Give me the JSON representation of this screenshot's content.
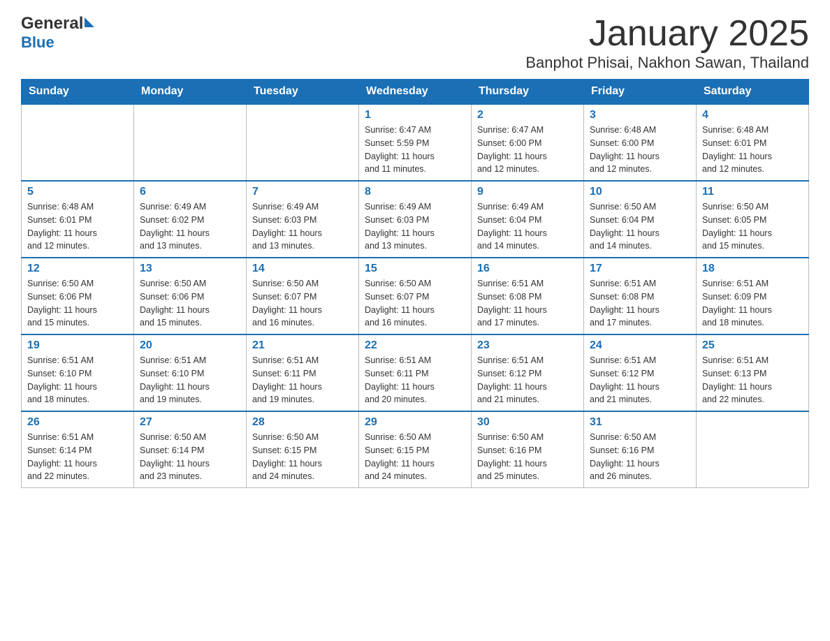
{
  "header": {
    "logo_text1": "General",
    "logo_text2": "Blue",
    "month_title": "January 2025",
    "location": "Banphot Phisai, Nakhon Sawan, Thailand"
  },
  "days_of_week": [
    "Sunday",
    "Monday",
    "Tuesday",
    "Wednesday",
    "Thursday",
    "Friday",
    "Saturday"
  ],
  "weeks": [
    [
      {
        "day": "",
        "info": ""
      },
      {
        "day": "",
        "info": ""
      },
      {
        "day": "",
        "info": ""
      },
      {
        "day": "1",
        "info": "Sunrise: 6:47 AM\nSunset: 5:59 PM\nDaylight: 11 hours\nand 11 minutes."
      },
      {
        "day": "2",
        "info": "Sunrise: 6:47 AM\nSunset: 6:00 PM\nDaylight: 11 hours\nand 12 minutes."
      },
      {
        "day": "3",
        "info": "Sunrise: 6:48 AM\nSunset: 6:00 PM\nDaylight: 11 hours\nand 12 minutes."
      },
      {
        "day": "4",
        "info": "Sunrise: 6:48 AM\nSunset: 6:01 PM\nDaylight: 11 hours\nand 12 minutes."
      }
    ],
    [
      {
        "day": "5",
        "info": "Sunrise: 6:48 AM\nSunset: 6:01 PM\nDaylight: 11 hours\nand 12 minutes."
      },
      {
        "day": "6",
        "info": "Sunrise: 6:49 AM\nSunset: 6:02 PM\nDaylight: 11 hours\nand 13 minutes."
      },
      {
        "day": "7",
        "info": "Sunrise: 6:49 AM\nSunset: 6:03 PM\nDaylight: 11 hours\nand 13 minutes."
      },
      {
        "day": "8",
        "info": "Sunrise: 6:49 AM\nSunset: 6:03 PM\nDaylight: 11 hours\nand 13 minutes."
      },
      {
        "day": "9",
        "info": "Sunrise: 6:49 AM\nSunset: 6:04 PM\nDaylight: 11 hours\nand 14 minutes."
      },
      {
        "day": "10",
        "info": "Sunrise: 6:50 AM\nSunset: 6:04 PM\nDaylight: 11 hours\nand 14 minutes."
      },
      {
        "day": "11",
        "info": "Sunrise: 6:50 AM\nSunset: 6:05 PM\nDaylight: 11 hours\nand 15 minutes."
      }
    ],
    [
      {
        "day": "12",
        "info": "Sunrise: 6:50 AM\nSunset: 6:06 PM\nDaylight: 11 hours\nand 15 minutes."
      },
      {
        "day": "13",
        "info": "Sunrise: 6:50 AM\nSunset: 6:06 PM\nDaylight: 11 hours\nand 15 minutes."
      },
      {
        "day": "14",
        "info": "Sunrise: 6:50 AM\nSunset: 6:07 PM\nDaylight: 11 hours\nand 16 minutes."
      },
      {
        "day": "15",
        "info": "Sunrise: 6:50 AM\nSunset: 6:07 PM\nDaylight: 11 hours\nand 16 minutes."
      },
      {
        "day": "16",
        "info": "Sunrise: 6:51 AM\nSunset: 6:08 PM\nDaylight: 11 hours\nand 17 minutes."
      },
      {
        "day": "17",
        "info": "Sunrise: 6:51 AM\nSunset: 6:08 PM\nDaylight: 11 hours\nand 17 minutes."
      },
      {
        "day": "18",
        "info": "Sunrise: 6:51 AM\nSunset: 6:09 PM\nDaylight: 11 hours\nand 18 minutes."
      }
    ],
    [
      {
        "day": "19",
        "info": "Sunrise: 6:51 AM\nSunset: 6:10 PM\nDaylight: 11 hours\nand 18 minutes."
      },
      {
        "day": "20",
        "info": "Sunrise: 6:51 AM\nSunset: 6:10 PM\nDaylight: 11 hours\nand 19 minutes."
      },
      {
        "day": "21",
        "info": "Sunrise: 6:51 AM\nSunset: 6:11 PM\nDaylight: 11 hours\nand 19 minutes."
      },
      {
        "day": "22",
        "info": "Sunrise: 6:51 AM\nSunset: 6:11 PM\nDaylight: 11 hours\nand 20 minutes."
      },
      {
        "day": "23",
        "info": "Sunrise: 6:51 AM\nSunset: 6:12 PM\nDaylight: 11 hours\nand 21 minutes."
      },
      {
        "day": "24",
        "info": "Sunrise: 6:51 AM\nSunset: 6:12 PM\nDaylight: 11 hours\nand 21 minutes."
      },
      {
        "day": "25",
        "info": "Sunrise: 6:51 AM\nSunset: 6:13 PM\nDaylight: 11 hours\nand 22 minutes."
      }
    ],
    [
      {
        "day": "26",
        "info": "Sunrise: 6:51 AM\nSunset: 6:14 PM\nDaylight: 11 hours\nand 22 minutes."
      },
      {
        "day": "27",
        "info": "Sunrise: 6:50 AM\nSunset: 6:14 PM\nDaylight: 11 hours\nand 23 minutes."
      },
      {
        "day": "28",
        "info": "Sunrise: 6:50 AM\nSunset: 6:15 PM\nDaylight: 11 hours\nand 24 minutes."
      },
      {
        "day": "29",
        "info": "Sunrise: 6:50 AM\nSunset: 6:15 PM\nDaylight: 11 hours\nand 24 minutes."
      },
      {
        "day": "30",
        "info": "Sunrise: 6:50 AM\nSunset: 6:16 PM\nDaylight: 11 hours\nand 25 minutes."
      },
      {
        "day": "31",
        "info": "Sunrise: 6:50 AM\nSunset: 6:16 PM\nDaylight: 11 hours\nand 26 minutes."
      },
      {
        "day": "",
        "info": ""
      }
    ]
  ]
}
